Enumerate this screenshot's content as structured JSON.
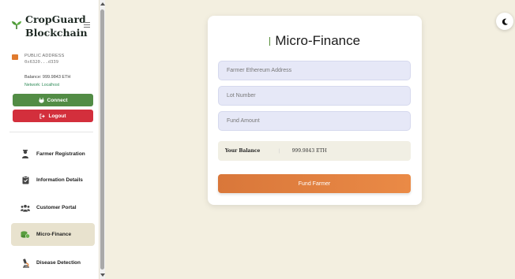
{
  "brand": {
    "title_line1": "CropGuard",
    "title_line2": "Blockchain"
  },
  "account": {
    "label": "PUBLIC ADDRESS",
    "address": "0x6320...d339",
    "balance": "Balance: 999.9843 ETH",
    "network": "Network: Localhost"
  },
  "buttons": {
    "connect": "Connect",
    "logout": "Logout"
  },
  "nav": [
    {
      "label": "Farmer Registration",
      "icon": "farmer-icon"
    },
    {
      "label": "Information Details",
      "icon": "clipboard-icon"
    },
    {
      "label": "Customer Portal",
      "icon": "users-icon"
    },
    {
      "label": "Micro-Finance",
      "icon": "coins-icon",
      "active": true
    },
    {
      "label": "Disease Detection",
      "icon": "microscope-icon"
    }
  ],
  "form": {
    "title": "Micro-Finance",
    "address_placeholder": "Farmer Ethereum Address",
    "lot_placeholder": "Lot Number",
    "amount_placeholder": "Fund Amount",
    "balance_label": "Your Balance",
    "balance_value": "999.9843 ETH",
    "submit": "Fund Farmer"
  },
  "colors": {
    "accent": "#e07a2e",
    "connect": "#528c45",
    "logout": "#d32f3c",
    "background": "#f3efe0"
  }
}
